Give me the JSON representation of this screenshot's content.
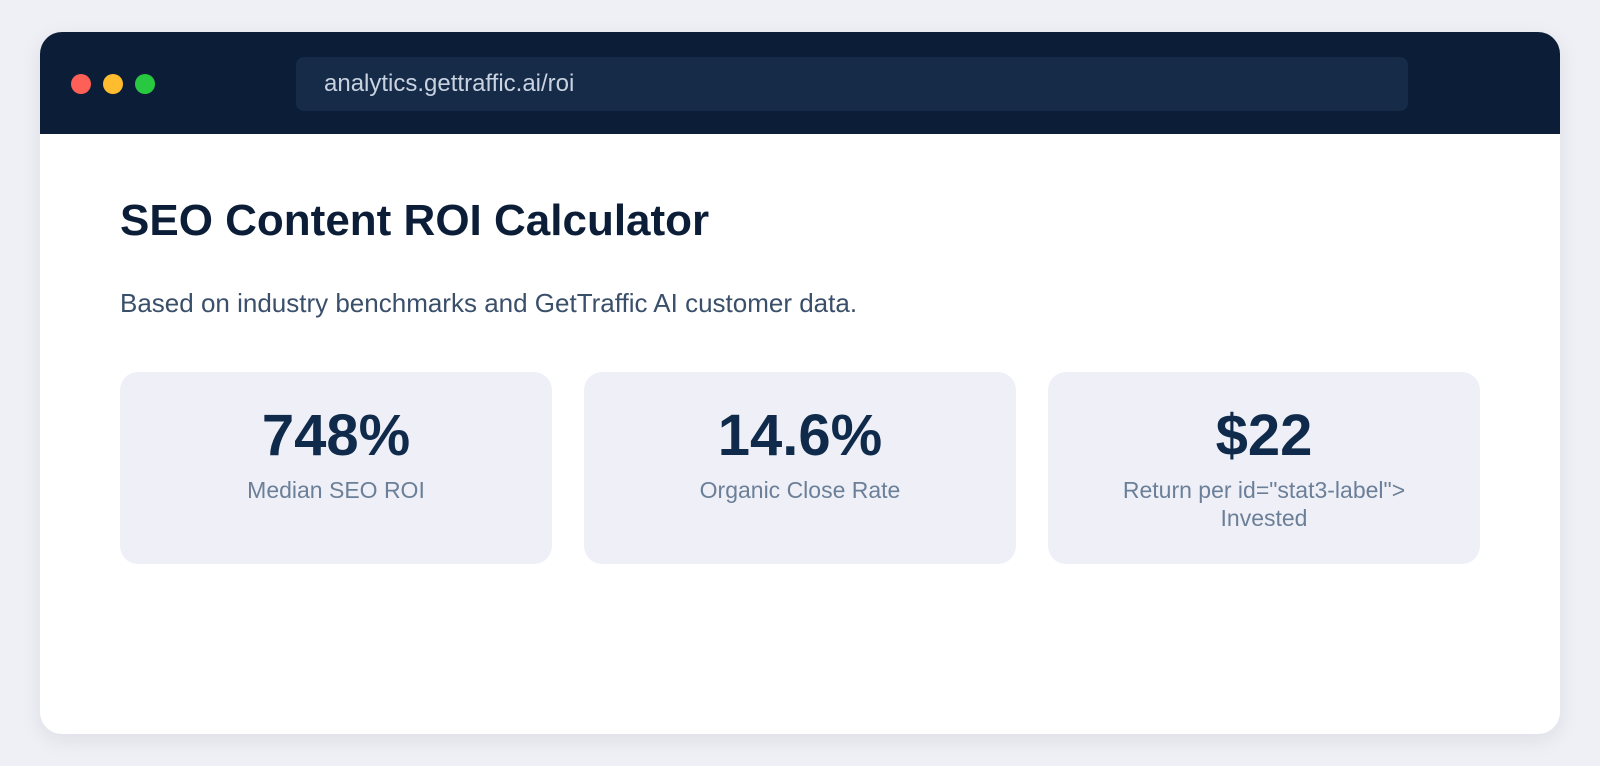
{
  "window": {
    "controls": [
      "close-dot",
      "minimize-dot",
      "maximize-dot"
    ],
    "url": "analytics.gettraffic.ai/roi"
  },
  "page": {
    "title": "SEO Content ROI Calculator",
    "subtitle": "Based on industry benchmarks and GetTraffic AI customer data."
  },
  "stats": [
    {
      "value": "748%",
      "label": "Median SEO ROI"
    },
    {
      "value": "14.6%",
      "label": "Organic Close Rate"
    },
    {
      "value": "$22",
      "label": "Return per id=\"stat3-label\"> Invested"
    }
  ],
  "colors": {
    "titlebar": "#0c1e37",
    "urlbar": "#152b48",
    "heading": "#0c1e37",
    "stat_value": "#0f2a4a",
    "stat_label": "#6b7f98",
    "card_bg": "#eff0f7",
    "close": "#fe5f57",
    "minimize": "#febc2e",
    "maximize": "#28c840"
  }
}
